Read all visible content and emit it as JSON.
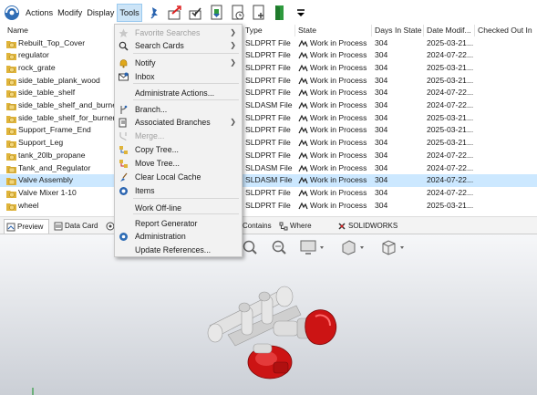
{
  "menubar": {
    "items": [
      "Actions",
      "Modify",
      "Display",
      "Tools"
    ],
    "active_index": 3
  },
  "table": {
    "headers": {
      "name": "Name",
      "type": "Type",
      "state": "State",
      "days": "Days In State",
      "date": "Date Modif...",
      "checked": "Checked Out In"
    },
    "rows": [
      {
        "name": "Rebuilt_Top_Cover",
        "type": "SLDPRT File",
        "state": "Work in Process",
        "days": "304",
        "date": "2025-03-21..."
      },
      {
        "name": "regulator",
        "type": "SLDPRT File",
        "state": "Work in Process",
        "days": "304",
        "date": "2024-07-22..."
      },
      {
        "name": "rock_grate",
        "type": "SLDPRT File",
        "state": "Work in Process",
        "days": "304",
        "date": "2025-03-21..."
      },
      {
        "name": "side_table_plank_wood",
        "type": "SLDPRT File",
        "state": "Work in Process",
        "days": "304",
        "date": "2025-03-21..."
      },
      {
        "name": "side_table_shelf",
        "type": "SLDPRT File",
        "state": "Work in Process",
        "days": "304",
        "date": "2024-07-22..."
      },
      {
        "name": "side_table_shelf_and_burner",
        "type": "SLDASM File",
        "state": "Work in Process",
        "days": "304",
        "date": "2024-07-22..."
      },
      {
        "name": "side_table_shelf_for_burner",
        "type": "SLDPRT File",
        "state": "Work in Process",
        "days": "304",
        "date": "2025-03-21..."
      },
      {
        "name": "Support_Frame_End",
        "type": "SLDPRT File",
        "state": "Work in Process",
        "days": "304",
        "date": "2025-03-21..."
      },
      {
        "name": "Support_Leg",
        "type": "SLDPRT File",
        "state": "Work in Process",
        "days": "304",
        "date": "2025-03-21..."
      },
      {
        "name": "tank_20lb_propane",
        "type": "SLDPRT File",
        "state": "Work in Process",
        "days": "304",
        "date": "2024-07-22..."
      },
      {
        "name": "Tank_and_Regulator",
        "type": "SLDASM File",
        "state": "Work in Process",
        "days": "304",
        "date": "2024-07-22..."
      },
      {
        "name": "Valve Assembly",
        "type": "SLDASM File",
        "state": "Work in Process",
        "days": "304",
        "date": "2024-07-22...",
        "selected": true
      },
      {
        "name": "Valve Mixer 1-10",
        "type": "SLDPRT File",
        "state": "Work in Process",
        "days": "304",
        "date": "2024-07-22..."
      },
      {
        "name": "wheel",
        "type": "SLDPRT File",
        "state": "Work in Process",
        "days": "304",
        "date": "2025-03-21..."
      }
    ]
  },
  "tabs": [
    {
      "label": "Preview",
      "icon": "preview-icon",
      "active": true
    },
    {
      "label": "Data Card",
      "icon": "data-card-icon"
    },
    {
      "label": "Contains",
      "icon": "contains-icon"
    },
    {
      "label": "Where Used",
      "icon": "where-used-icon"
    },
    {
      "label": "SOLIDWORKS Manage",
      "icon": "solidworks-manage-icon"
    }
  ],
  "dropdown": {
    "items": [
      {
        "label": "Favorite Searches",
        "icon": "star-icon",
        "disabled": true,
        "submenu": true
      },
      {
        "label": "Search Cards",
        "icon": "search-icon",
        "submenu": true
      },
      {
        "label": "Notify",
        "icon": "bell-icon",
        "submenu": true
      },
      {
        "label": "Inbox",
        "icon": "inbox-icon"
      },
      {
        "label": "Administrate Actions..."
      },
      {
        "label": "Branch...",
        "icon": "branch-icon"
      },
      {
        "label": "Associated Branches",
        "icon": "branches-icon",
        "submenu": true
      },
      {
        "label": "Merge...",
        "icon": "merge-icon",
        "disabled": true
      },
      {
        "label": "Copy Tree...",
        "icon": "copy-tree-icon"
      },
      {
        "label": "Move Tree...",
        "icon": "move-tree-icon"
      },
      {
        "label": "Clear Local Cache",
        "icon": "broom-icon"
      },
      {
        "label": "Items",
        "icon": "items-icon"
      },
      {
        "label": "Work Off-line"
      },
      {
        "label": "Report Generator"
      },
      {
        "label": "Administration",
        "icon": "administration-icon"
      },
      {
        "label": "Update References..."
      }
    ]
  },
  "colors": {
    "selected_row": "#cce8ff",
    "menu_active": "#cce4f7",
    "valve_red": "#cc1414"
  }
}
